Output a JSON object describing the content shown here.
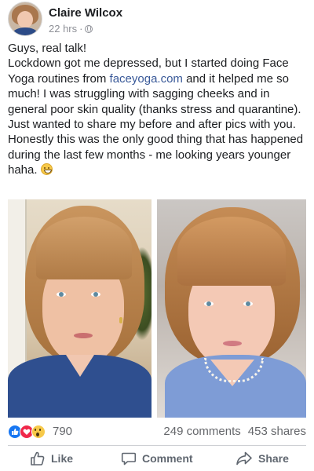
{
  "post": {
    "author": "Claire Wilcox",
    "time": "22 hrs",
    "separator": "·",
    "privacy_icon": "globe-icon",
    "text": {
      "p1": "Guys, real talk!",
      "p2_before": "Lockdown got me depressed, but I started doing Face Yoga routines from ",
      "p2_link": "faceyoga.com",
      "p2_after": " and it helped me so much! I was struggling with sagging cheeks and in general poor skin quality (thanks stress and quarantine).",
      "p3": "Just wanted to share my before and after pics with you. Honestly this was the only good thing that has happened during the last few months - me looking years younger haha.",
      "emoji": "grinning-face-emoji"
    },
    "photos": [
      {
        "name": "before-photo",
        "icon": "woman-portrait-blue-shirt"
      },
      {
        "name": "after-photo",
        "icon": "woman-portrait-pearl-necklace"
      }
    ]
  },
  "reactions": {
    "icons": [
      "like-reaction-icon",
      "love-reaction-icon",
      "wow-reaction-icon"
    ],
    "count": "790",
    "comments": "249 comments",
    "shares": "453 shares"
  },
  "actions": {
    "like": "Like",
    "comment": "Comment",
    "share": "Share"
  },
  "colors": {
    "link": "#385898",
    "meta": "#8e9097",
    "action": "#606770",
    "like_blue": "#1877f2",
    "love_red": "#f0284a",
    "wow_yellow": "#f7c949"
  }
}
